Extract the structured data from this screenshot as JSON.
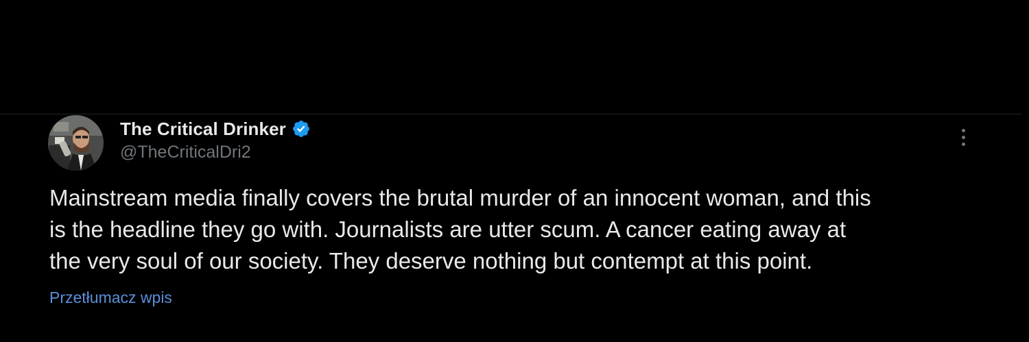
{
  "tweet": {
    "author": {
      "display_name": "The Critical Drinker",
      "handle": "@TheCriticalDri2",
      "verified": true,
      "verified_icon": "verified-badge-icon",
      "avatar_icon": "profile-avatar"
    },
    "text": "Mainstream media finally covers the brutal murder of an innocent woman, and this\nis the headline they go with. Journalists are utter scum. A cancer eating away at\nthe very soul of our society. They deserve nothing but contempt at this point.",
    "translate_label": "Przetłumacz wpis",
    "more_icon": "more-options-icon"
  },
  "colors": {
    "background": "#000000",
    "primary_text": "#e7e9ea",
    "secondary_text": "#71767b",
    "link": "#5b8fd8",
    "verified": "#1d9bf0"
  }
}
